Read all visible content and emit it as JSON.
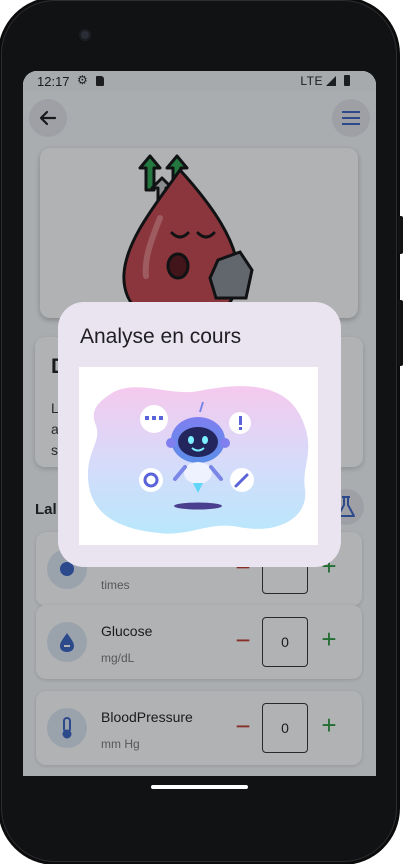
{
  "status": {
    "time": "12:17",
    "network": "LTE"
  },
  "colors": {
    "minus": "#c0392b",
    "plus": "#2e9a40",
    "dialog_bg": "#eae4f0",
    "accent_icon": "#3b63c4"
  },
  "app_bar": {
    "back_icon": "arrow-left-icon",
    "menu_icon": "hamburger-menu-icon"
  },
  "description": {
    "title": "D",
    "lines": [
      "L",
      "a",
      "s"
    ]
  },
  "lab": {
    "title": "Lal"
  },
  "rows": [
    {
      "name": "",
      "unit": "times",
      "value": ""
    },
    {
      "name": "Glucose",
      "unit": "mg/dL",
      "value": "0"
    },
    {
      "name": "BloodPressure",
      "unit": "mm Hg",
      "value": "0"
    }
  ],
  "controls": {
    "minus": "−",
    "plus": "+"
  },
  "dialog": {
    "title": "Analyse en cours"
  }
}
